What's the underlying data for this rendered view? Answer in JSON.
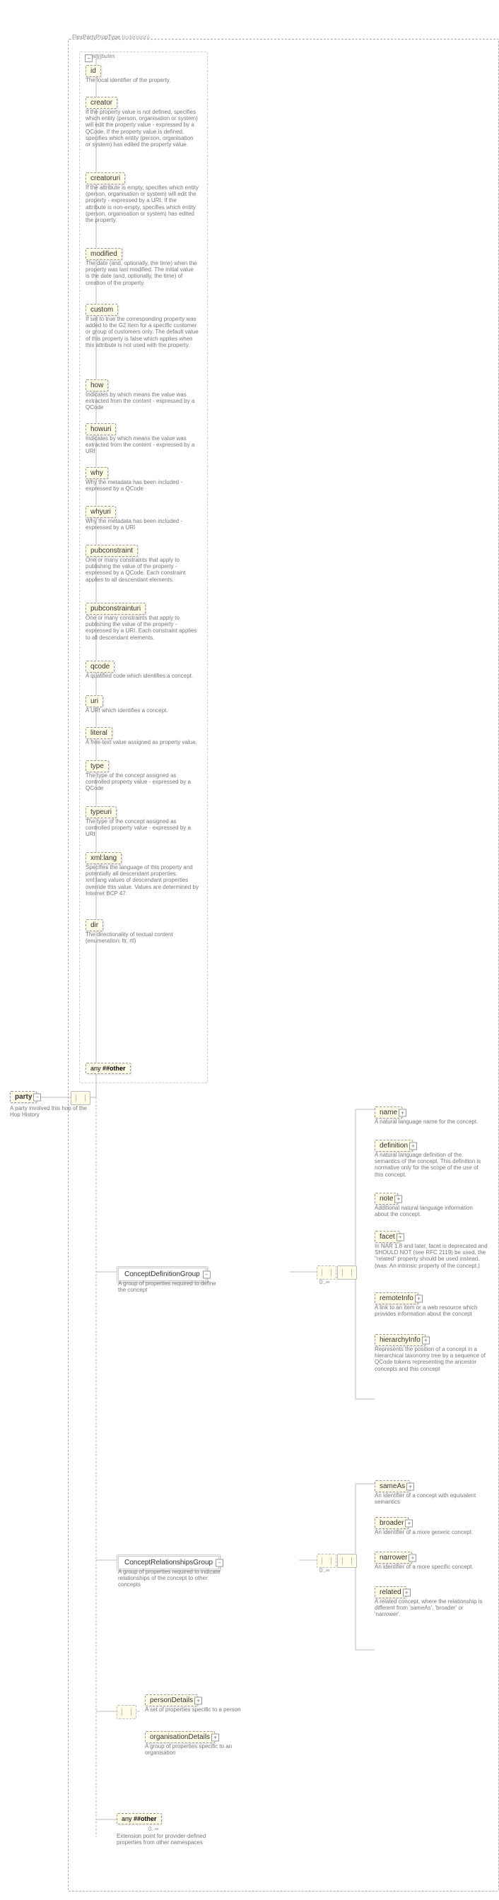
{
  "root": {
    "name": "party",
    "desc": "A party involved this hop of the Hop History"
  },
  "extensionType": "FlexPartyPropType",
  "extensionTag": "(extension)",
  "attributesLabel": "attributes",
  "attributes": [
    {
      "name": "id",
      "desc": "The local identifier of the property."
    },
    {
      "name": "creator",
      "desc": "If the property value is not defined, specifies which entity (person, organisation or system) will edit the property value - expressed by a QCode. If the property value is defined, specifies which entity (person, organisation or system) has edited the property value."
    },
    {
      "name": "creatoruri",
      "desc": "If the attribute is empty, specifies which entity (person, organisation or system) will edit the property - expressed by a URI. If the attribute is non-empty, specifies which entity (person, organisation or system) has edited the property."
    },
    {
      "name": "modified",
      "desc": "The date (and, optionally, the time) when the property was last modified. The initial value is the date (and, optionally, the time) of creation of the property."
    },
    {
      "name": "custom",
      "desc": "If set to true the corresponding property was added to the G2 Item for a specific customer or group of customers only. The default value of this property is false which applies when this attribute is not used with the property."
    },
    {
      "name": "how",
      "desc": "Indicates by which means the value was extracted from the content - expressed by a QCode"
    },
    {
      "name": "howuri",
      "desc": "Indicates by which means the value was extracted from the content - expressed by a URI"
    },
    {
      "name": "why",
      "desc": "Why the metadata has been included - expressed by a QCode"
    },
    {
      "name": "whyuri",
      "desc": "Why the metadata has been included - expressed by a URI"
    },
    {
      "name": "pubconstraint",
      "desc": "One or many constraints that apply to publishing the value of the property - expressed by a QCode. Each constraint applies to all descendant elements."
    },
    {
      "name": "pubconstrainturi",
      "desc": "One or many constraints that apply to publishing the value of the property - expressed by a URI. Each constraint applies to all descendant elements."
    },
    {
      "name": "qcode",
      "desc": "A qualified code which identifies a concept."
    },
    {
      "name": "uri",
      "desc": "A URI which identifies a concept."
    },
    {
      "name": "literal",
      "desc": "A free-text value assigned as property value."
    },
    {
      "name": "type",
      "desc": "The type of the concept assigned as controlled property value - expressed by a QCode"
    },
    {
      "name": "typeuri",
      "desc": "The type of the concept assigned as controlled property value - expressed by a URI"
    },
    {
      "name": "xml:lang",
      "desc": "Specifies the language of this property and potentially all descendant properties. xml:lang values of descendant properties override this value. Values are determined by Internet BCP 47."
    },
    {
      "name": "dir",
      "desc": "The directionality of textual content (enumeration: ltr, rtl)"
    }
  ],
  "anyOther": {
    "label": "any",
    "ns": "##other"
  },
  "groups": {
    "def": {
      "name": "ConceptDefinitionGroup",
      "desc": "A group of properties required to define the concept",
      "card": "0..∞"
    },
    "rel": {
      "name": "ConceptRelationshipsGroup",
      "desc": "A group of properties required to indicate relationships of the concept to other concepts",
      "card": "0..∞"
    }
  },
  "defChildren": [
    {
      "name": "name",
      "desc": "A natural language name for the concept."
    },
    {
      "name": "definition",
      "desc": "A natural language definition of the semantics of the concept. This definition is normative only for the scope of the use of this concept."
    },
    {
      "name": "note",
      "desc": "Additional natural language information about the concept."
    },
    {
      "name": "facet",
      "desc": "In NAR 1.8 and later, facet is deprecated and SHOULD NOT (see RFC 2119) be used, the \"related\" property should be used instead.(was: An intrinsic property of the concept.)"
    },
    {
      "name": "remoteInfo",
      "desc": "A link to an item or a web resource which provides information about the concept"
    },
    {
      "name": "hierarchyInfo",
      "desc": "Represents the position of a concept in a hierarchical taxonomy tree by a sequence of QCode tokens representing the ancestor concepts and this concept"
    }
  ],
  "relChildren": [
    {
      "name": "sameAs",
      "desc": "An identifier of a concept with equivalent semantics"
    },
    {
      "name": "broader",
      "desc": "An identifier of a more generic concept."
    },
    {
      "name": "narrower",
      "desc": "An identifier of a more specific concept."
    },
    {
      "name": "related",
      "desc": "A related concept, where the relationship is different from 'sameAs', 'broader' or 'narrower'."
    }
  ],
  "entityChoice": [
    {
      "name": "personDetails",
      "desc": "A set of properties specific to a person"
    },
    {
      "name": "organisationDetails",
      "desc": "A group of properties specific to an organisation"
    }
  ],
  "anyBottom": {
    "label": "any",
    "ns": "##other",
    "card": "0..∞",
    "desc": "Extension point for provider-defined properties from other namespaces"
  }
}
